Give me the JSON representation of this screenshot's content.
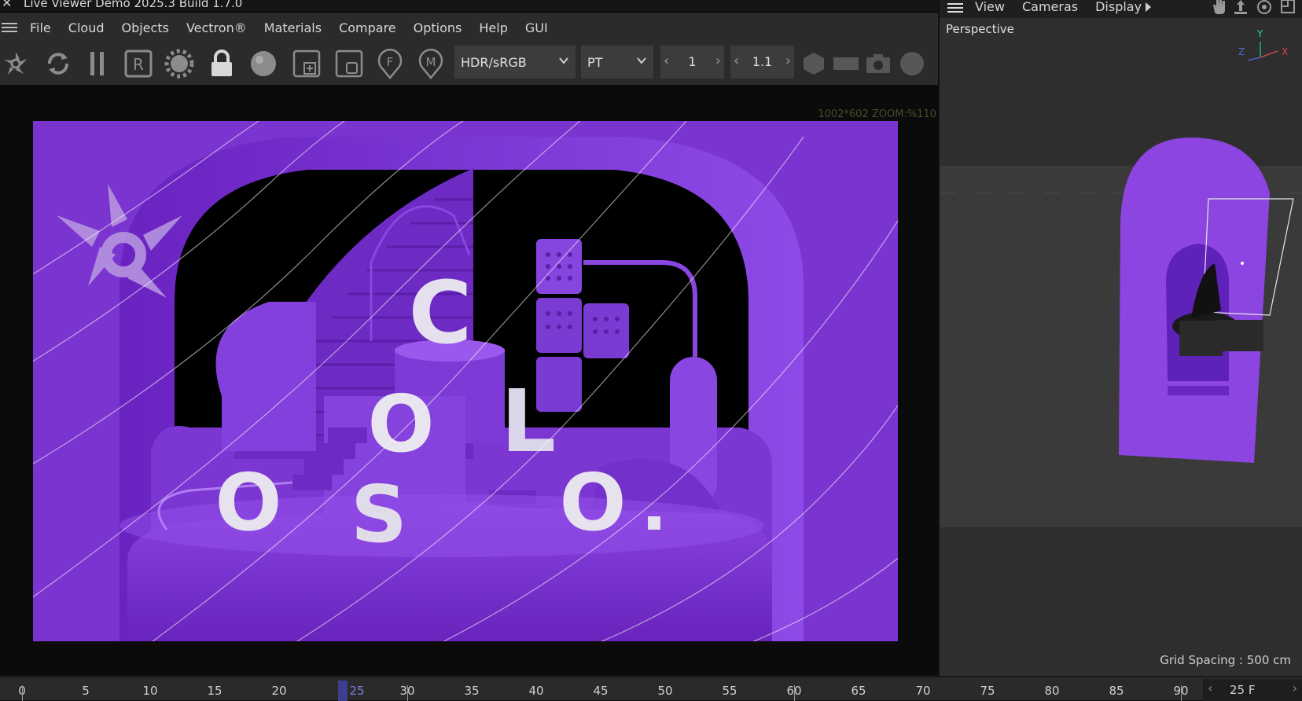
{
  "window": {
    "title": "Live Viewer Demo 2025.3 Build 1.7.0",
    "close_glyph": "✕"
  },
  "menu": {
    "items": [
      "File",
      "Cloud",
      "Objects",
      "Vectron®",
      "Materials",
      "Compare",
      "Options",
      "Help",
      "GUI"
    ]
  },
  "toolbar": {
    "icons": [
      "octane-logo-icon",
      "refresh-icon",
      "pause-icon",
      "r-box-icon",
      "gear-icon",
      "lock-icon",
      "sphere-icon",
      "add-region-icon",
      "region-icon",
      "focus-pin-icon",
      "material-pin-icon"
    ],
    "render_mode": "HDR/sRGB",
    "kernel": "PT",
    "stepper1_value": "1",
    "stepper2_value": "1.1",
    "right_icons": [
      "hexagon-icon",
      "rect-icon",
      "camera-icon",
      "circle-icon"
    ]
  },
  "viewport": {
    "zoom_info": "1002*602 ZOOM:%110",
    "render_letters": [
      "C",
      "O",
      "L",
      "O",
      "S",
      "O",
      "."
    ]
  },
  "right_panel": {
    "menu": [
      "View",
      "Cameras",
      "Display"
    ],
    "view_label": "Perspective",
    "axis_labels": {
      "x": "X",
      "y": "Y",
      "z": "Z"
    },
    "grid_spacing": "Grid Spacing : 500 cm",
    "header_icons": [
      "hand-icon",
      "move-icon",
      "orbit-icon",
      "maximize-icon"
    ]
  },
  "timeline": {
    "ticks": [
      "0",
      "5",
      "10",
      "15",
      "20",
      "25",
      "30",
      "35",
      "40",
      "45",
      "50",
      "55",
      "60",
      "65",
      "70",
      "75",
      "80",
      "85",
      "90"
    ],
    "current_frame": "25",
    "frame_field": "25 F"
  },
  "colors": {
    "render_bg": "#7a33cc",
    "accent": "#3e3e90",
    "ui_bg": "#2b2b2b"
  }
}
